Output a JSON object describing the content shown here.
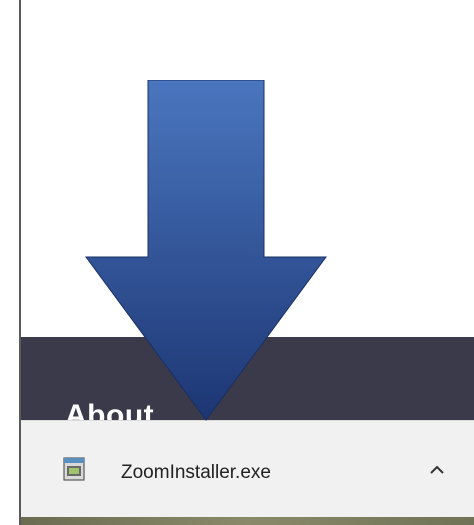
{
  "footer": {
    "heading": "About"
  },
  "download": {
    "file_name": "ZoomInstaller.exe",
    "file_icon": "exe-file-icon",
    "toggle_icon": "chevron-up-icon"
  },
  "overlay": {
    "arrow_icon": "down-arrow-icon",
    "arrow_color_top": "#4a76bf",
    "arrow_color_bottom": "#1d3673"
  }
}
